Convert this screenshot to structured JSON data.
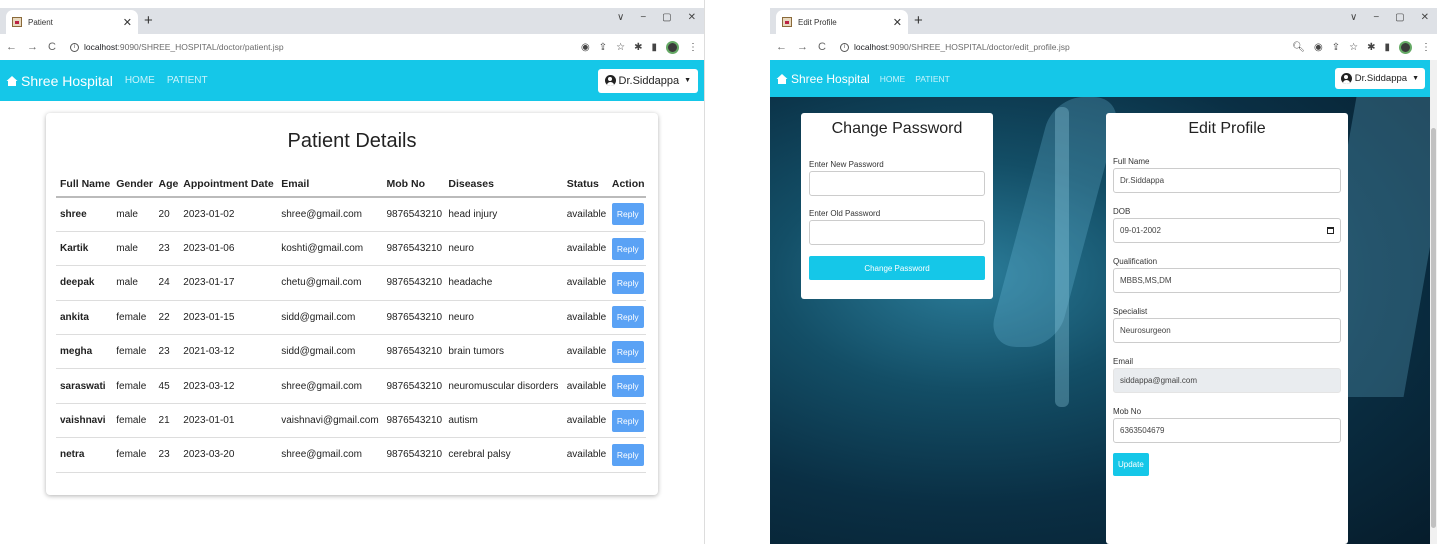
{
  "left_window": {
    "tab_title": "Patient",
    "url_host": "localhost",
    "url_path": ":9090/SHREE_HOSPITAL/doctor/patient.jsp",
    "brand": "Shree Hospital",
    "nav": [
      "HOME",
      "PATIENT"
    ],
    "user": "Dr.Siddappa",
    "heading": "Patient Details",
    "columns": [
      "Full Name",
      "Gender",
      "Age",
      "Appointment Date",
      "Email",
      "Mob No",
      "Diseases",
      "Status",
      "Action"
    ],
    "rows": [
      [
        "shree",
        "male",
        "20",
        "2023-01-02",
        "shree@gmail.com",
        "9876543210",
        "head injury",
        "available",
        "Reply"
      ],
      [
        "Kartik",
        "male",
        "23",
        "2023-01-06",
        "koshti@gmail.com",
        "9876543210",
        "neuro",
        "available",
        "Reply"
      ],
      [
        "deepak",
        "male",
        "24",
        "2023-01-17",
        "chetu@gmail.com",
        "9876543210",
        "headache",
        "available",
        "Reply"
      ],
      [
        "ankita",
        "female",
        "22",
        "2023-01-15",
        "sidd@gmail.com",
        "9876543210",
        "neuro",
        "available",
        "Reply"
      ],
      [
        "megha",
        "female",
        "23",
        "2021-03-12",
        "sidd@gmail.com",
        "9876543210",
        "brain tumors",
        "available",
        "Reply"
      ],
      [
        "saraswati",
        "female",
        "45",
        "2023-03-12",
        "shree@gmail.com",
        "9876543210",
        "neuromuscular disorders",
        "available",
        "Reply"
      ],
      [
        "vaishnavi",
        "female",
        "21",
        "2023-01-01",
        "vaishnavi@gmail.com",
        "9876543210",
        "autism",
        "available",
        "Reply"
      ],
      [
        "netra",
        "female",
        "23",
        "2023-03-20",
        "shree@gmail.com",
        "9876543210",
        "cerebral palsy",
        "available",
        "Reply"
      ]
    ]
  },
  "right_window": {
    "tab_title": "Edit Profile",
    "url_host": "localhost",
    "url_path": ":9090/SHREE_HOSPITAL/doctor/edit_profile.jsp",
    "brand": "Shree Hospital",
    "nav": [
      "HOME",
      "PATIENT"
    ],
    "user": "Dr.Siddappa",
    "change_password": {
      "title": "Change Password",
      "new_label": "Enter New Password",
      "old_label": "Enter Old Password",
      "button": "Change Password"
    },
    "edit_profile": {
      "title": "Edit Profile",
      "fields": [
        {
          "label": "Full Name",
          "value": "Dr.Siddappa"
        },
        {
          "label": "DOB",
          "value": "09-01-2002"
        },
        {
          "label": "Qualification",
          "value": "MBBS,MS,DM"
        },
        {
          "label": "Specialist",
          "value": "Neurosurgeon"
        },
        {
          "label": "Email",
          "value": "siddappa@gmail.com"
        },
        {
          "label": "Mob No",
          "value": "6363504679"
        }
      ],
      "button": "Update"
    }
  },
  "window_controls": [
    "∨",
    "−",
    "▢",
    "✕"
  ],
  "colors": {
    "navbar": "#15c7e8",
    "reply": "#5aa2f5",
    "accent": "#a21a5a"
  }
}
